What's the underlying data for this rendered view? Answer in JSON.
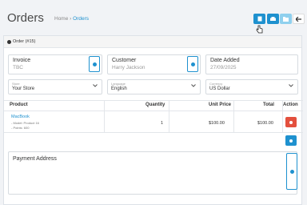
{
  "header": {
    "title": "Orders",
    "breadcrumb_home": "Home",
    "breadcrumb_sep": "›",
    "breadcrumb_current": "Orders"
  },
  "toolbar": {
    "icons": [
      "invoice-icon",
      "print-icon",
      "folder-icon",
      "back-icon"
    ]
  },
  "card": {
    "heading": "Order (#15)"
  },
  "fields": {
    "invoice_label": "Invoice",
    "invoice_value": "TBC",
    "customer_label": "Customer",
    "customer_value": "Harry Jackson",
    "date_label": "Date Added",
    "date_value": "27/09/2025"
  },
  "selects": {
    "store_label": "Store",
    "store_value": "Your Store",
    "language_label": "Language",
    "language_value": "English",
    "currency_label": "Currency",
    "currency_value": "US Dollar"
  },
  "table": {
    "headers": [
      "Product",
      "Quantity",
      "Unit Price",
      "Total",
      "Action"
    ],
    "rows": [
      {
        "product": "MacBook",
        "model": "- Model: Product 16",
        "points": "- Points: 600",
        "quantity": "1",
        "unit_price": "$100.00",
        "total": "$100.00"
      }
    ]
  },
  "payment": {
    "label": "Payment Address"
  },
  "colors": {
    "primary": "#1e91cf",
    "danger": "#e3503e",
    "light_blue": "#8fd0ee"
  }
}
